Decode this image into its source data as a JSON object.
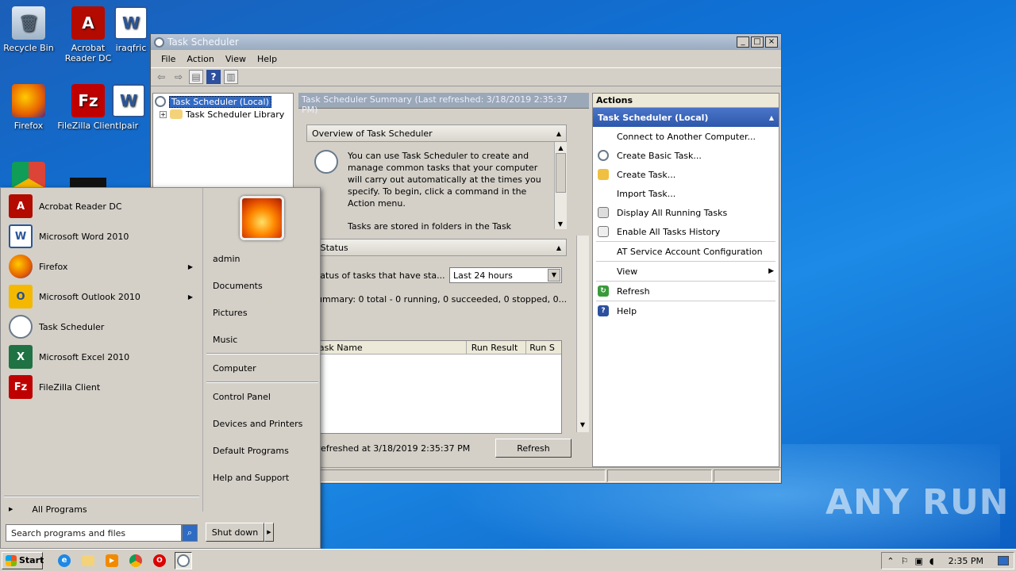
{
  "desktop": {
    "icons": [
      {
        "label": "Recycle Bin",
        "icon": "recycle-bin-icon"
      },
      {
        "label": "Acrobat Reader DC",
        "icon": "acrobat-icon"
      },
      {
        "label": "iraqfric",
        "icon": "word-doc-icon"
      },
      {
        "label": "Firefox",
        "icon": "firefox-icon"
      },
      {
        "label": "FileZilla Client",
        "icon": "filezilla-icon"
      },
      {
        "label": "lpair",
        "icon": "word-doc-icon"
      }
    ]
  },
  "window": {
    "title": "Task Scheduler",
    "menu": [
      "File",
      "Action",
      "View",
      "Help"
    ],
    "tree": [
      "Task Scheduler (Local)",
      "Task Scheduler Library"
    ],
    "center": {
      "header": "Task Scheduler Summary (Last refreshed: 3/18/2019 2:35:37 PM)",
      "overview_title": "Overview of Task Scheduler",
      "overview_text": "You can use Task Scheduler to create and manage common tasks that your computer will carry out automatically at the times you specify. To begin, click a command in the Action menu.",
      "overview_text2": "Tasks are stored in folders in the Task",
      "status_title": "sk Status",
      "status_label": "Status of tasks that have sta...",
      "status_select": "Last 24 hours",
      "summary": "Summary: 0 total - 0 running, 0 succeeded, 0 stopped, 0...",
      "columns": [
        "Task Name",
        "Run Result",
        "Run S"
      ],
      "last_refreshed": "t refreshed at 3/18/2019 2:35:37 PM",
      "refresh_btn": "Refresh"
    },
    "actions": {
      "header": "Actions",
      "selected": "Task Scheduler (Local)",
      "items": [
        "Connect to Another Computer...",
        "Create Basic Task...",
        "Create Task...",
        "Import Task...",
        "Display All Running Tasks",
        "Enable All Tasks History",
        "AT Service Account Configuration",
        "View",
        "Refresh",
        "Help"
      ]
    }
  },
  "startmenu": {
    "programs": [
      "Acrobat Reader DC",
      "Microsoft Word 2010",
      "Firefox",
      "Microsoft Outlook 2010",
      "Task Scheduler",
      "Microsoft Excel 2010",
      "FileZilla Client"
    ],
    "all_programs": "All Programs",
    "search_placeholder": "Search programs and files",
    "places": [
      "admin",
      "Documents",
      "Pictures",
      "Music",
      "Computer",
      "Control Panel",
      "Devices and Printers",
      "Default Programs",
      "Help and Support"
    ],
    "shutdown": "Shut down"
  },
  "taskbar": {
    "start": "Start",
    "clock": "2:35 PM"
  },
  "watermark": "ANY RUN"
}
